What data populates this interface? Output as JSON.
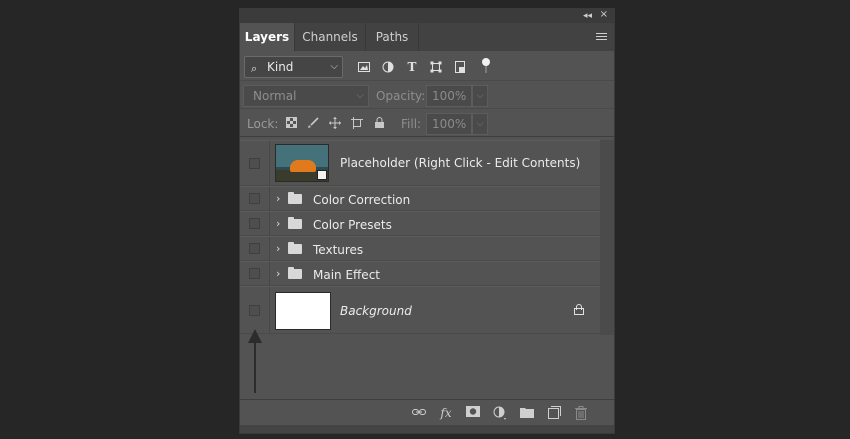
{
  "panel": {
    "top_icons": {
      "collapse": "collapse-arrows-icon",
      "close": "close-icon"
    },
    "tabs": [
      {
        "label": "Layers",
        "active": true
      },
      {
        "label": "Channels",
        "active": false
      },
      {
        "label": "Paths",
        "active": false
      }
    ],
    "filter": {
      "kind_label": "Kind",
      "icons": [
        "pixel-filter-icon",
        "adjustment-filter-icon",
        "type-filter-icon",
        "shape-filter-icon",
        "smartobject-filter-icon",
        "filter-toggle-icon"
      ]
    },
    "blend": {
      "mode": "Normal",
      "opacity_label": "Opacity:",
      "opacity_value": "100%"
    },
    "lock": {
      "label": "Lock:",
      "fill_label": "Fill:",
      "fill_value": "100%",
      "icons": [
        "lock-transparent-icon",
        "lock-image-icon",
        "lock-position-icon",
        "lock-artboard-icon",
        "lock-all-icon"
      ]
    },
    "layers": [
      {
        "type": "smartobject",
        "name": "Placeholder (Right Click - Edit Contents)"
      },
      {
        "type": "group",
        "name": "Color Correction"
      },
      {
        "type": "group",
        "name": "Color Presets"
      },
      {
        "type": "group",
        "name": "Textures"
      },
      {
        "type": "group",
        "name": "Main Effect"
      },
      {
        "type": "background",
        "name": "Background",
        "locked": true
      }
    ],
    "bottom_icons": [
      "link-icon",
      "fx-icon",
      "mask-icon",
      "adjustment-icon",
      "new-group-icon",
      "new-layer-icon",
      "trash-icon"
    ],
    "colors": {
      "panel_bg": "#535353",
      "page_bg": "#262626",
      "accent_text": "#ffffff"
    }
  }
}
